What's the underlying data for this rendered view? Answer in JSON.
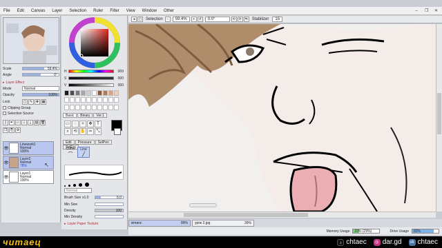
{
  "menu": [
    "File",
    "Edit",
    "Canvas",
    "Layer",
    "Selection",
    "Ruler",
    "Filter",
    "View",
    "Window",
    "Other"
  ],
  "window_buttons": [
    "–",
    "❐",
    "✕"
  ],
  "nav": {
    "scale_label": "Scale",
    "scale_value": "59.4%",
    "angle_label": "Angle",
    "angle_value": "0°"
  },
  "layer_panel": {
    "effect_label": "Layer Effect",
    "mode_label": "Mode",
    "mode_value": "Normal",
    "opacity_label": "Opacity",
    "opacity_value": "100%",
    "lock_label": "Lock",
    "clipping_label": "Clipping Group",
    "selection_source_label": "Selection Source",
    "layers": [
      {
        "name": "Linework1",
        "mode": "Normal",
        "opacity": "100%"
      },
      {
        "name": "Layer2",
        "mode": "Normal",
        "opacity": "78%"
      },
      {
        "name": "Layer1",
        "mode": "Normal",
        "opacity": "100%"
      }
    ]
  },
  "color": {
    "h_label": "H",
    "h_value": "009",
    "s_label": "S",
    "s_value": "000",
    "v_label": "V",
    "v_value": "000",
    "current": "#000000",
    "swatches": [
      "#1a1a1a",
      "#4d4d4d",
      "#7a7a7a",
      "#a6a6a6",
      "#cfcfcf",
      "#ffffff",
      "#8a5a3c",
      "#b07b55",
      "#d9a58a",
      "#f1cdb7"
    ]
  },
  "tool_tabs": [
    "Basic",
    "Binary",
    "Ver.1"
  ],
  "brush_tabs": [
    "Edit",
    "Pressure",
    "SelPen",
    "SelErs"
  ],
  "brush_tools": [
    "Curve",
    "Line"
  ],
  "brush": {
    "mode_value": "Normal",
    "size_label": "Brush Size",
    "size_mult": "x1.0",
    "size_value": "5.0",
    "min_size_label": "Min Size",
    "density_label": "Density",
    "density_value": "100",
    "min_density_label": "Min Density",
    "paper_label": "Layer Paper Texture"
  },
  "canvas_toolbar": {
    "selection_label": "Selection",
    "zoom_value": "59.4%",
    "angle_value": "0.0°",
    "stabilizer_label": "Stabilizer",
    "stabilizer_value": "15"
  },
  "doc_tabs": [
    {
      "name": "кimинс",
      "pct": "89%"
    },
    {
      "name": "урок 2.jpg",
      "pct": "39%"
    }
  ],
  "status": {
    "memory_label": "Memory Usage",
    "memory_value": "23% (29%)",
    "drive_label": "Drive Usage",
    "drive_value": "82%"
  },
  "overlay": {
    "brand": "читаец",
    "tiktok": "chtaec",
    "instagram": "dar.gd",
    "vk": "chtaec"
  }
}
